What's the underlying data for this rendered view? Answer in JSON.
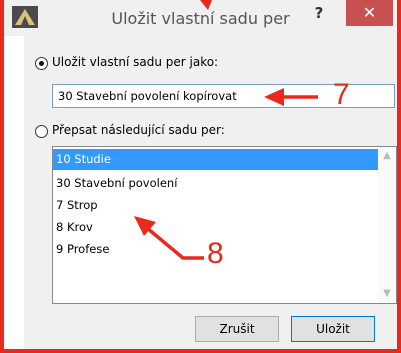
{
  "window": {
    "title": "Uložit vlastní sadu per",
    "help_label": "?",
    "close_label": "✕"
  },
  "option_save": {
    "label": "Uložit vlastní sadu per jako:",
    "checked": true,
    "value": "30 Stavební povolení kopírovat"
  },
  "option_overwrite": {
    "label": "Přepsat následující sadu per:",
    "checked": false,
    "items": [
      "10 Studie",
      "30 Stavební povolení",
      "7 Strop",
      "8 Krov",
      "9 Profese"
    ],
    "selected_index": 0
  },
  "buttons": {
    "cancel": "Zrušit",
    "save": "Uložit"
  },
  "annotations": {
    "label_7": "7",
    "label_8": "8",
    "color": "#e8291c"
  }
}
